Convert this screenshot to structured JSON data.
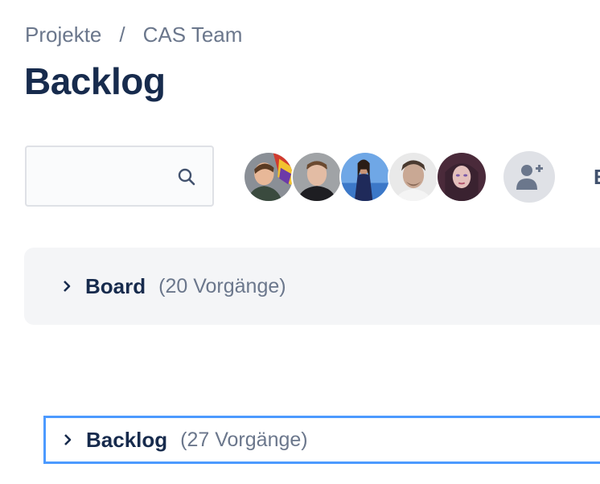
{
  "breadcrumb": {
    "items": [
      "Projekte",
      "CAS Team"
    ],
    "separator": "/"
  },
  "page": {
    "title": "Backlog"
  },
  "search": {
    "value": "",
    "placeholder": "",
    "icon": "search-icon"
  },
  "people": {
    "avatars": [
      {
        "icon": "avatar-person-1"
      },
      {
        "icon": "avatar-person-2"
      },
      {
        "icon": "avatar-person-3"
      },
      {
        "icon": "avatar-person-4"
      },
      {
        "icon": "avatar-person-5"
      }
    ],
    "add_user_icon": "add-user-icon"
  },
  "toolbar": {
    "cut_off_text": "E"
  },
  "sprints": [
    {
      "name": "Board",
      "count_label": "(20 Vorgänge)",
      "expanded": false
    },
    {
      "name": "Backlog",
      "count_label": "(27 Vorgänge)",
      "expanded": false,
      "focused": true
    }
  ],
  "colors": {
    "title": "#172b4d",
    "muted": "#6b778c",
    "panel": "#f4f5f7",
    "focus_border": "#4c9aff"
  }
}
